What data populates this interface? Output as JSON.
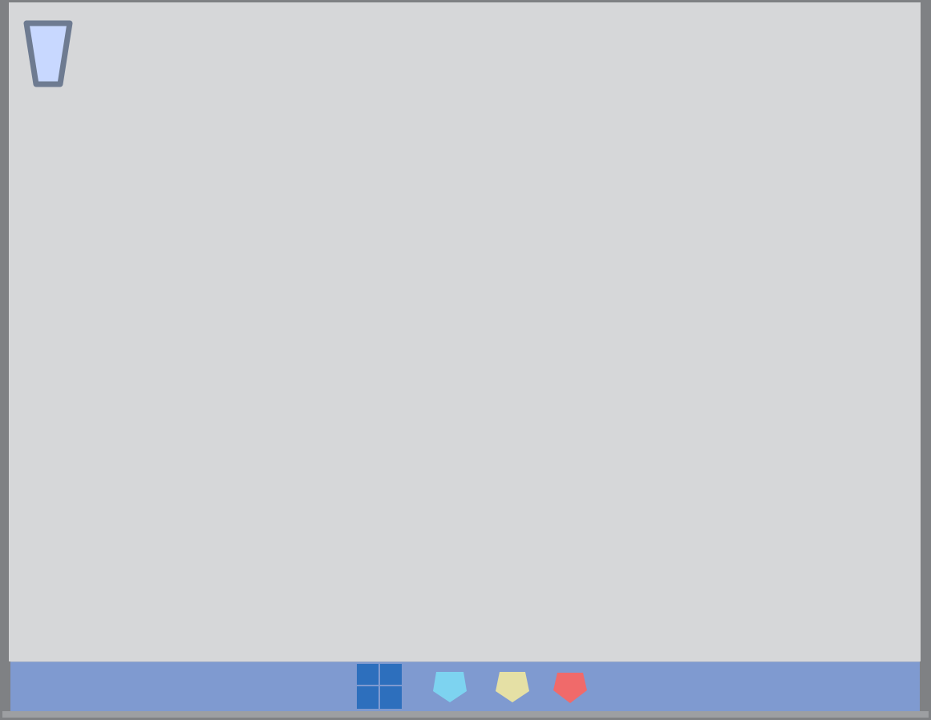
{
  "desktop": {
    "background_color": "#d6d7d9",
    "icons": [
      {
        "name": "recycle-bin-icon",
        "fill": "#c8d8ff",
        "stroke": "#6e7b91"
      }
    ]
  },
  "taskbar": {
    "background_color": "#7f9ad0",
    "start": {
      "icon": "windows-start-icon",
      "color": "#2d6fbd"
    },
    "apps": [
      {
        "icon": "pentagon-app-icon",
        "color": "#7dd3f0"
      },
      {
        "icon": "pentagon-app-icon",
        "color": "#e5e0a5"
      },
      {
        "icon": "pentagon-app-icon",
        "color": "#f06a6a"
      }
    ]
  }
}
